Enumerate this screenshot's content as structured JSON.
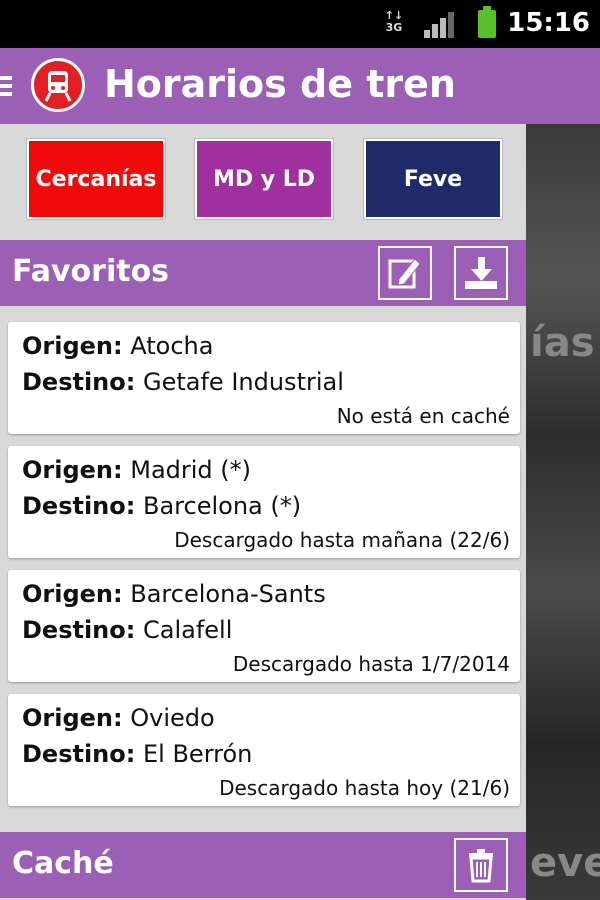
{
  "status_bar": {
    "network": "3G",
    "time": "15:16"
  },
  "app": {
    "title": "Horarios de tren"
  },
  "categories": [
    {
      "label": "Cercanías",
      "color": "#f20a0a"
    },
    {
      "label": "MD y LD",
      "color": "#a02fa0"
    },
    {
      "label": "Feve",
      "color": "#1f2a6b"
    }
  ],
  "favorites": {
    "title": "Favoritos",
    "origin_label": "Origen:",
    "destination_label": "Destino:",
    "items": [
      {
        "origin": "Atocha",
        "destination": "Getafe Industrial",
        "status": "No está en caché"
      },
      {
        "origin": "Madrid (*)",
        "destination": "Barcelona (*)",
        "status": "Descargado hasta mañana (22/6)"
      },
      {
        "origin": "Barcelona-Sants",
        "destination": "Calafell",
        "status": "Descargado hasta 1/7/2014"
      },
      {
        "origin": "Oviedo",
        "destination": "El Berrón",
        "status": "Descargado hasta hoy (21/6)"
      }
    ]
  },
  "cache": {
    "title": "Caché"
  },
  "background": {
    "text_1": "ías",
    "text_2": "eve"
  },
  "colors": {
    "header": "#9c5fb6",
    "logo": "#e31f26"
  }
}
